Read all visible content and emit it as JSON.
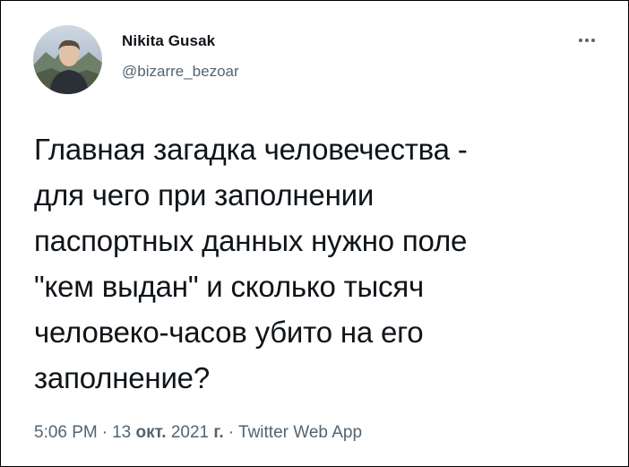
{
  "author": {
    "name": "Nikita Gusak",
    "handle": "@bizarre_bezoar"
  },
  "more_icon": "more-horizontal-icon",
  "tweet": {
    "text": "Главная загадка человечества -\nдля чего при заполнении\nпаспортных данных нужно поле\n\"кем выдан\" и сколько тысяч\nчеловеко-часов убито на его\nзаполнение?"
  },
  "meta": {
    "time": "5:06 PM",
    "separator": "·",
    "date_day": "13",
    "date_month": "окт.",
    "date_year": "2021",
    "date_suffix": "г.",
    "source": "Twitter Web App"
  },
  "colors": {
    "text_primary": "#0f1419",
    "text_secondary": "#536471"
  }
}
